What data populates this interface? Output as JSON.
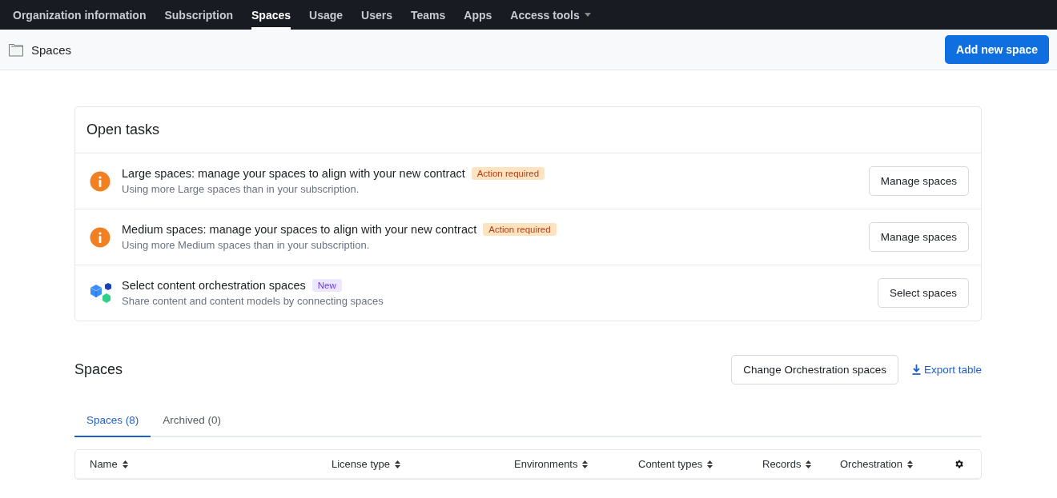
{
  "nav": {
    "items": [
      {
        "label": "Organization information",
        "selected": false
      },
      {
        "label": "Subscription",
        "selected": false
      },
      {
        "label": "Spaces",
        "selected": true
      },
      {
        "label": "Usage",
        "selected": false
      },
      {
        "label": "Users",
        "selected": false
      },
      {
        "label": "Teams",
        "selected": false
      },
      {
        "label": "Apps",
        "selected": false
      },
      {
        "label": "Access tools",
        "selected": false,
        "dropdown": true
      }
    ]
  },
  "header": {
    "title": "Spaces",
    "button": "Add new space"
  },
  "open_tasks": {
    "title": "Open tasks",
    "tasks": [
      {
        "kind": "info",
        "title": "Large spaces: manage your spaces to align with your new contract",
        "badge": {
          "kind": "warning",
          "label": "Action required"
        },
        "description": "Using more Large spaces than in your subscription.",
        "button": "Manage spaces"
      },
      {
        "kind": "info",
        "title": "Medium spaces: manage your spaces to align with your new contract",
        "badge": {
          "kind": "warning",
          "label": "Action required"
        },
        "description": "Using more Medium spaces than in your subscription.",
        "button": "Manage spaces"
      },
      {
        "kind": "orchestration",
        "title": "Select content orchestration spaces",
        "badge": {
          "kind": "new",
          "label": "New"
        },
        "description": "Share content and content models by connecting spaces",
        "button": "Select spaces"
      }
    ]
  },
  "spaces": {
    "title": "Spaces",
    "change_button": "Change Orchestration spaces",
    "export_link": "Export table",
    "tabs": [
      {
        "label": "Spaces (8)",
        "selected": true
      },
      {
        "label": "Archived (0)",
        "selected": false
      }
    ],
    "table": {
      "columns": [
        "Name",
        "License type",
        "Environments",
        "Content types",
        "Records",
        "Orchestration"
      ]
    }
  }
}
